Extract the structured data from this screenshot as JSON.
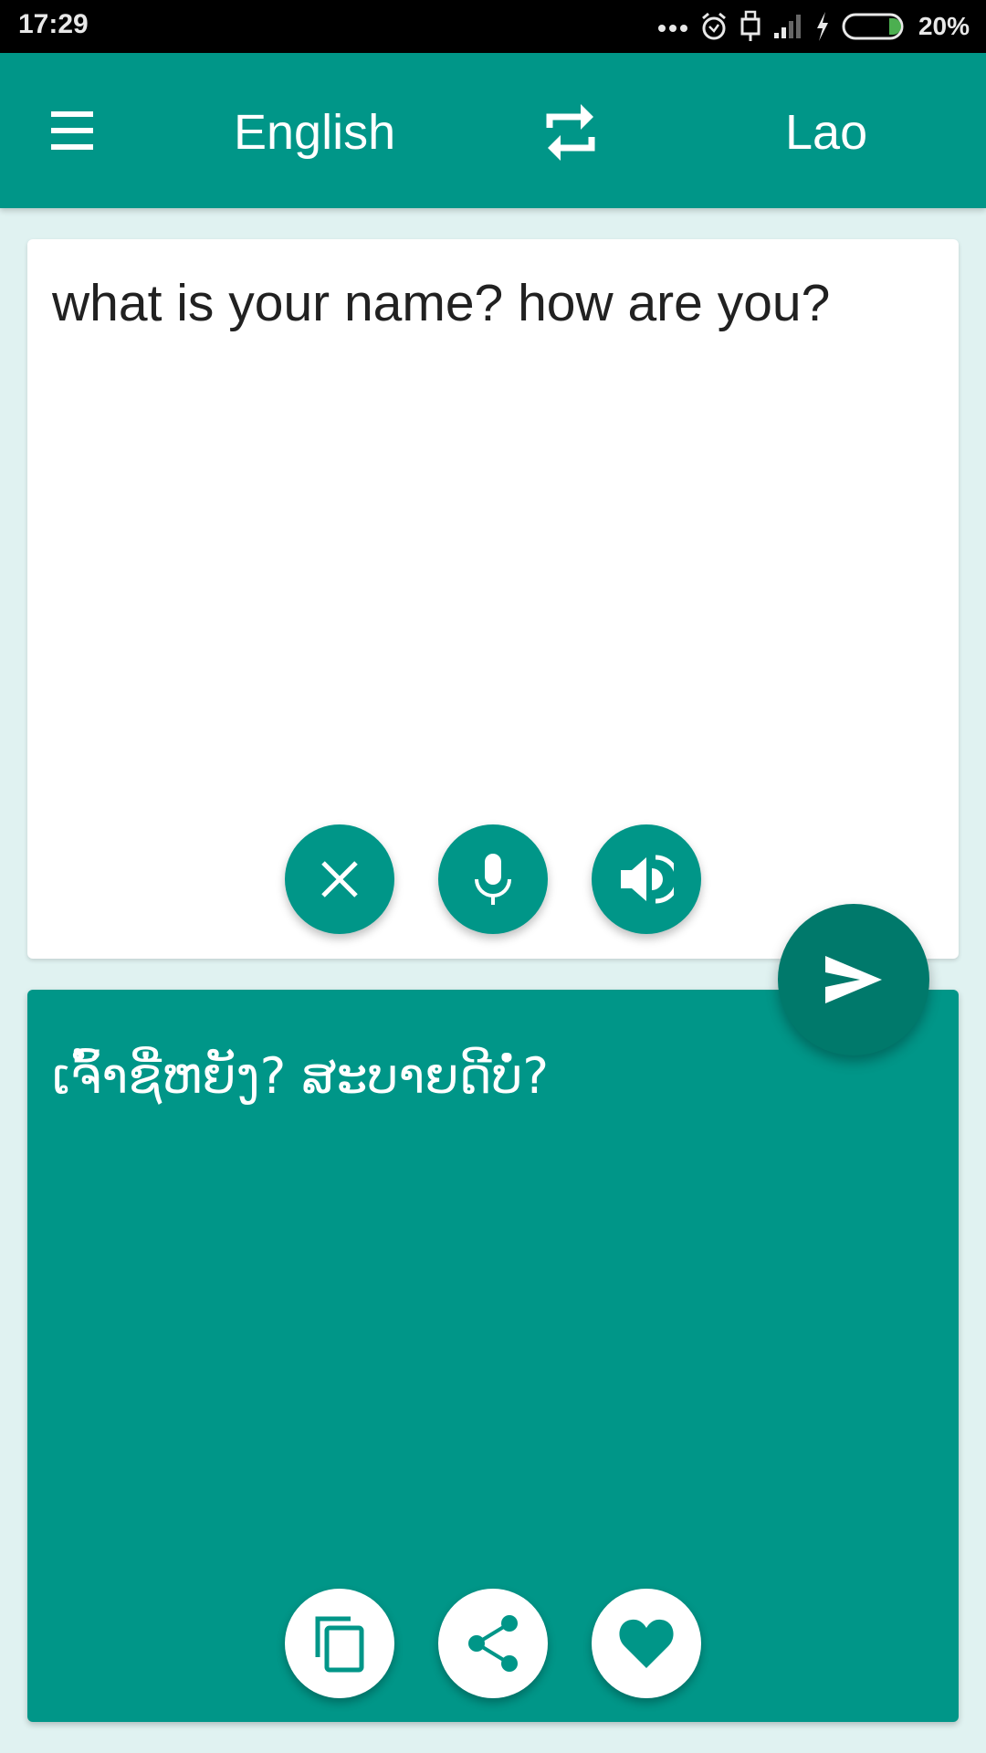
{
  "status_bar": {
    "time": "17:29",
    "battery_percent": "20%",
    "battery_level": 0.2,
    "icons": [
      "more-dots-icon",
      "alarm-icon",
      "usb-icon",
      "signal-icon",
      "charging-icon",
      "battery-icon"
    ]
  },
  "toolbar": {
    "menu_icon": "hamburger-menu-icon",
    "source_language": "English",
    "swap_icon": "swap-languages-icon",
    "target_language": "Lao"
  },
  "input": {
    "text": "what is your name? how are you?",
    "buttons": [
      {
        "name": "clear",
        "icon": "close-icon"
      },
      {
        "name": "voice-input",
        "icon": "microphone-icon"
      },
      {
        "name": "speak",
        "icon": "speaker-icon"
      }
    ]
  },
  "translate_button": {
    "icon": "send-icon"
  },
  "output": {
    "text": "ເຈົ້າຊື່ຫຍັງ? ສະບາຍດີບໍ່?",
    "buttons": [
      {
        "name": "copy",
        "icon": "copy-icon"
      },
      {
        "name": "share",
        "icon": "share-icon"
      },
      {
        "name": "favorite",
        "icon": "heart-icon"
      }
    ]
  },
  "colors": {
    "primary": "#009688",
    "primary_dark": "#00796b",
    "background": "#e0f2f1",
    "input_text": "#212121",
    "battery_fill": "#4caf50"
  }
}
